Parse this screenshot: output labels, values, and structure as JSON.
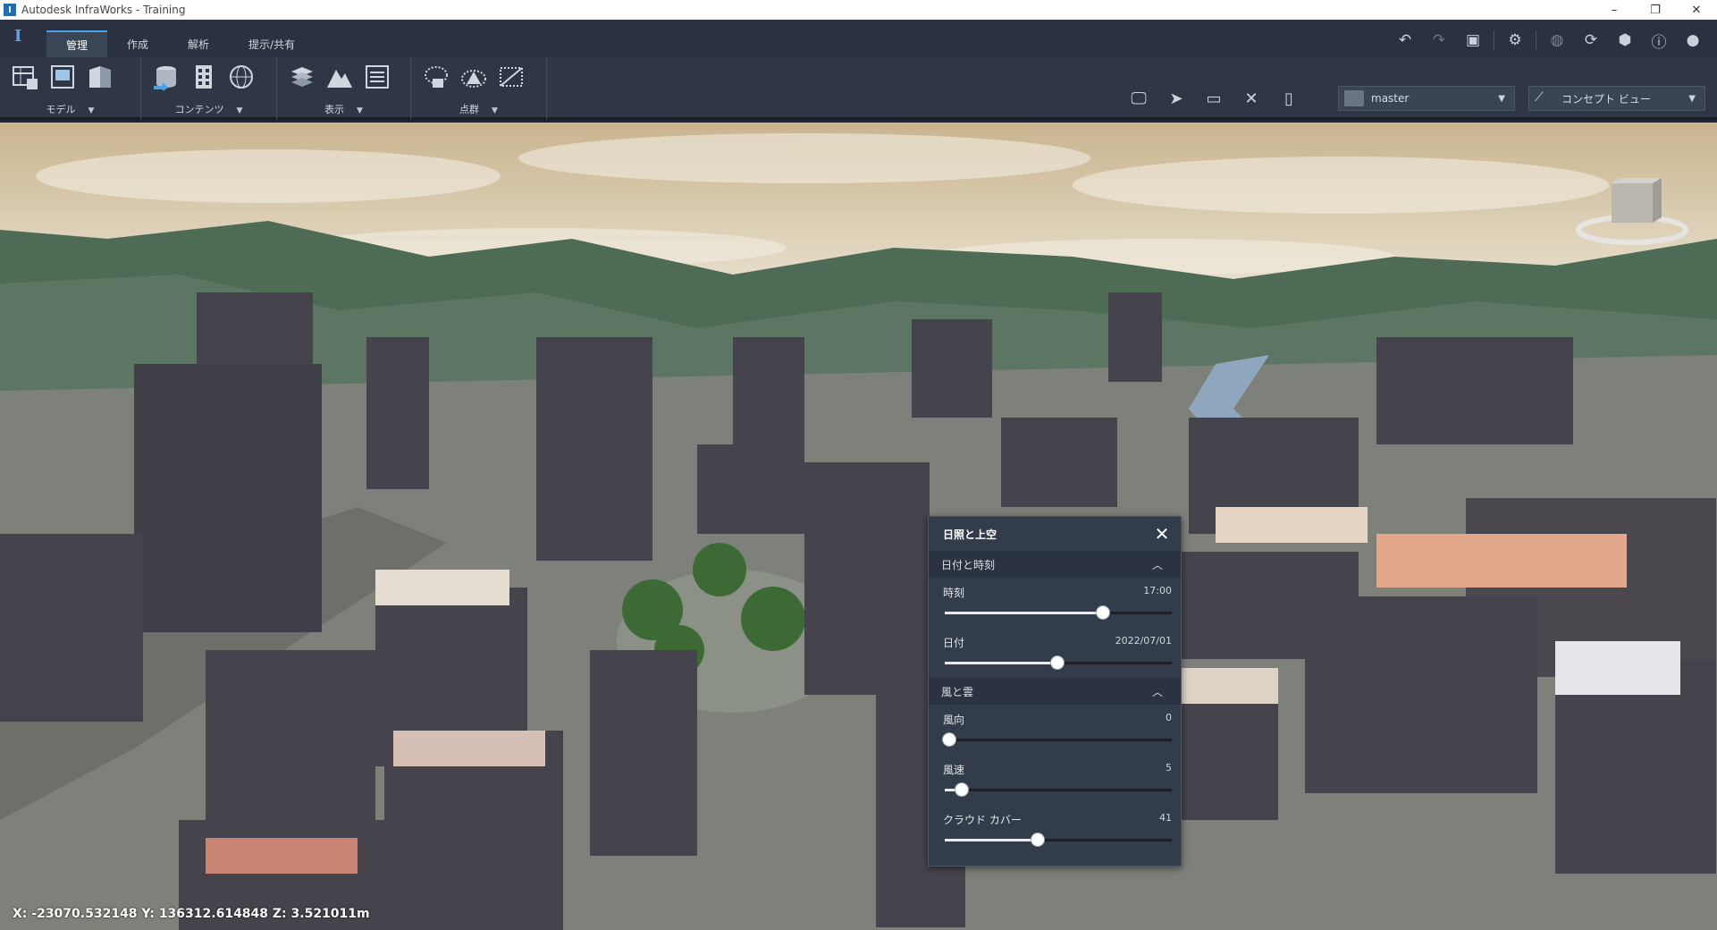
{
  "window": {
    "title": "Autodesk InfraWorks - Training",
    "app_icon": "I",
    "controls": {
      "minimize": "–",
      "restore": "❐",
      "close": "✕"
    }
  },
  "ribbon": {
    "tabs": [
      {
        "label": "管理",
        "active": true
      },
      {
        "label": "作成",
        "active": false
      },
      {
        "label": "解析",
        "active": false
      },
      {
        "label": "提示/共有",
        "active": false
      }
    ],
    "groups": [
      {
        "label": "モデル",
        "icons": [
          "model-table-icon",
          "model-layout-icon",
          "model-book-icon"
        ]
      },
      {
        "label": "コンテンツ",
        "icons": [
          "data-source-icon",
          "building-icon",
          "globe-icon"
        ]
      },
      {
        "label": "表示",
        "icons": [
          "layers-icon",
          "terrain-icon",
          "list-icon"
        ]
      },
      {
        "label": "点群",
        "icons": [
          "point-cloud-icon",
          "point-cloud-terrain-icon",
          "point-cloud-slice-icon"
        ]
      }
    ],
    "top_icons": [
      "undo-icon",
      "redo-icon",
      "split-view-icon",
      "settings-icon",
      "globe-sync-icon",
      "refresh-icon",
      "cube-icon",
      "help-icon",
      "user-icon"
    ],
    "view_tools": [
      "presentation-icon",
      "select-arrow-icon",
      "measure-icon",
      "tools-icon",
      "bookmark-icon"
    ],
    "proposal_dropdown": {
      "value": "master"
    },
    "style_dropdown": {
      "value": "コンセプト ビュー"
    }
  },
  "viewport": {
    "coordinates": "X: -23070.532148 Y: 136312.614848 Z: 3.521011m"
  },
  "sun_sky_panel": {
    "title": "日照と上空",
    "sections": [
      {
        "title": "日付と時刻",
        "rows": [
          {
            "label": "時刻",
            "value": "17:00",
            "fraction": 0.695
          },
          {
            "label": "日付",
            "value": "2022/07/01",
            "fraction": 0.495
          }
        ]
      },
      {
        "title": "風と雲",
        "rows": [
          {
            "label": "風向",
            "value": "0",
            "fraction": 0.02
          },
          {
            "label": "風速",
            "value": "5",
            "fraction": 0.075
          },
          {
            "label": "クラウド カバー",
            "value": "41",
            "fraction": 0.41
          }
        ]
      }
    ]
  }
}
